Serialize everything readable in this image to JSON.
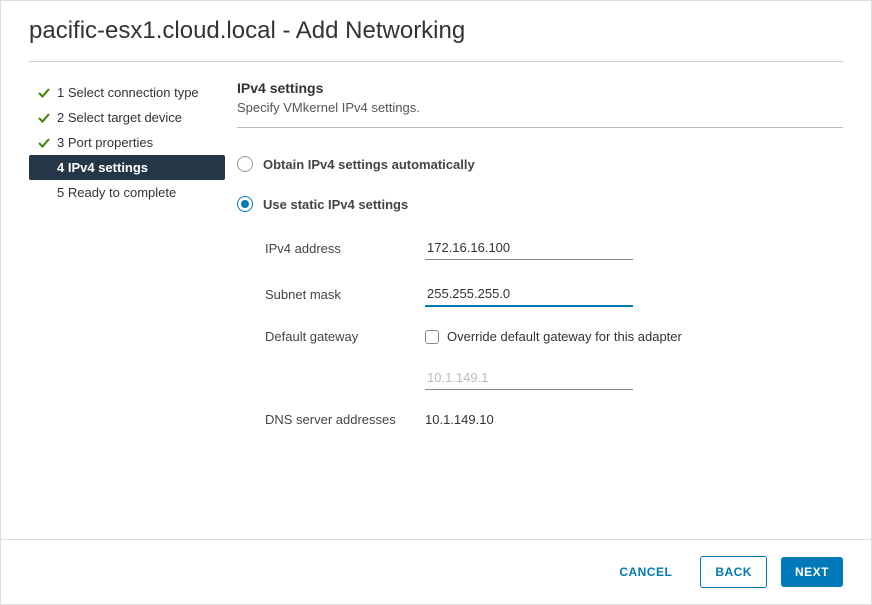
{
  "header": {
    "title": "pacific-esx1.cloud.local - Add Networking"
  },
  "nav": {
    "items": [
      {
        "label": "1 Select connection type",
        "state": "done"
      },
      {
        "label": "2 Select target device",
        "state": "done"
      },
      {
        "label": "3 Port properties",
        "state": "done"
      },
      {
        "label": "4 IPv4 settings",
        "state": "active"
      },
      {
        "label": "5 Ready to complete",
        "state": "pending"
      }
    ]
  },
  "content": {
    "title": "IPv4 settings",
    "subtitle": "Specify VMkernel IPv4 settings.",
    "radios": {
      "auto": "Obtain IPv4 settings automatically",
      "static": "Use static IPv4 settings"
    },
    "fields": {
      "ipv4_label": "IPv4 address",
      "ipv4_value": "172.16.16.100",
      "subnet_label": "Subnet mask",
      "subnet_value": "255.255.255.0",
      "gateway_label": "Default gateway",
      "gateway_override_label": "Override default gateway for this adapter",
      "gateway_value": "10.1.149.1",
      "dns_label": "DNS server addresses",
      "dns_value": "10.1.149.10"
    }
  },
  "footer": {
    "cancel": "CANCEL",
    "back": "BACK",
    "next": "NEXT"
  }
}
